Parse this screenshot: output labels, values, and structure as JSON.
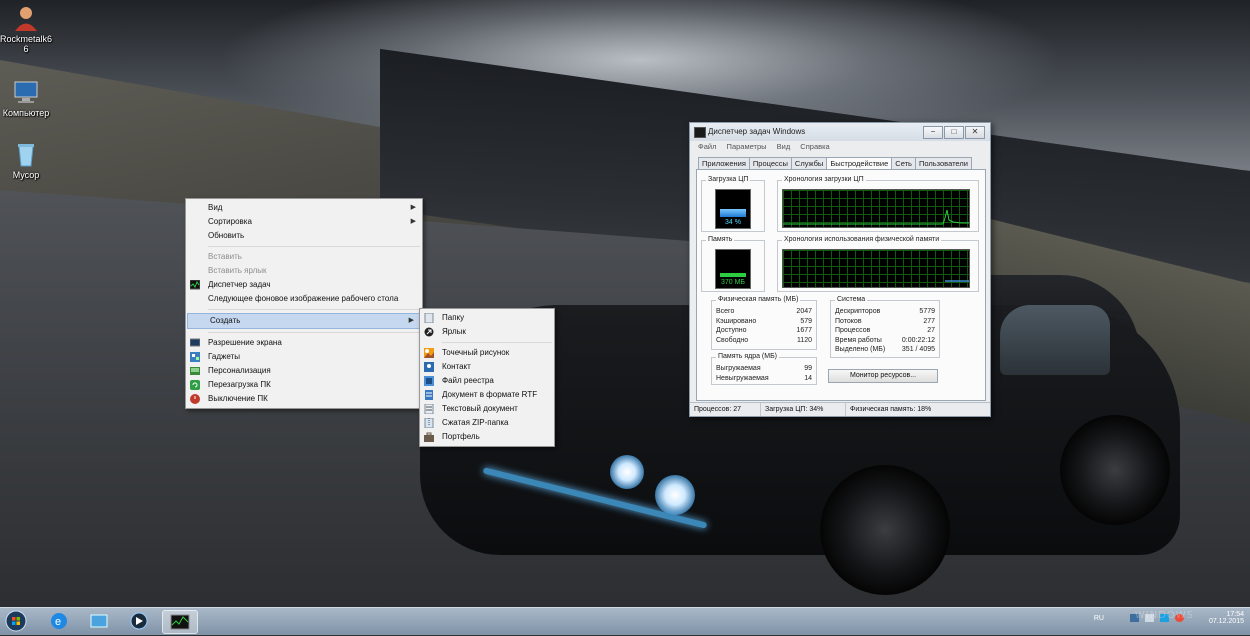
{
  "desktop": {
    "icons": [
      {
        "label": "Rockmetalk6 6",
        "icon": "user-icon"
      },
      {
        "label": "Компьютер",
        "icon": "computer-icon"
      },
      {
        "label": "Мусор",
        "icon": "recycle-bin-icon"
      }
    ]
  },
  "context_menu": {
    "items": [
      {
        "label": "Вид",
        "submenu": true
      },
      {
        "label": "Сортировка",
        "submenu": true
      },
      {
        "label": "Обновить"
      },
      {
        "label": "Вставить",
        "disabled": true
      },
      {
        "label": "Вставить ярлык",
        "disabled": true
      },
      {
        "label": "Диспетчер задач",
        "icon": "task-manager-icon"
      },
      {
        "label": "Следующее фоновое изображение рабочего стола"
      },
      {
        "label": "Создать",
        "submenu": true,
        "highlighted": true
      },
      {
        "label": "Разрешение экрана",
        "icon": "display-icon"
      },
      {
        "label": "Гаджеты",
        "icon": "gadgets-icon"
      },
      {
        "label": "Персонализация",
        "icon": "personalization-icon"
      },
      {
        "label": "Перезагрузка ПК",
        "icon": "restart-icon"
      },
      {
        "label": "Выключение ПК",
        "icon": "shutdown-icon"
      }
    ]
  },
  "create_submenu": {
    "items": [
      {
        "label": "Папку",
        "icon": "folder-icon"
      },
      {
        "label": "Ярлык",
        "icon": "shortcut-icon"
      },
      {
        "label": "Точечный рисунок",
        "icon": "bitmap-icon"
      },
      {
        "label": "Контакт",
        "icon": "contact-icon"
      },
      {
        "label": "Файл реестра",
        "icon": "registry-icon"
      },
      {
        "label": "Документ в формате RTF",
        "icon": "rtf-icon"
      },
      {
        "label": "Текстовый документ",
        "icon": "text-document-icon"
      },
      {
        "label": "Сжатая ZIP-папка",
        "icon": "zip-folder-icon"
      },
      {
        "label": "Портфель",
        "icon": "briefcase-icon"
      }
    ]
  },
  "task_manager": {
    "title": "Диспетчер задач Windows",
    "menu": [
      "Файл",
      "Параметры",
      "Вид",
      "Справка"
    ],
    "tabs": [
      "Приложения",
      "Процессы",
      "Службы",
      "Быстродействие",
      "Сеть",
      "Пользователи"
    ],
    "active_tab": "Быстродействие",
    "cpu_label": "Загрузка ЦП",
    "cpu_value": "34 %",
    "cpu_history_label": "Хронология загрузки ЦП",
    "memory_label": "Память",
    "memory_value": "370 МБ",
    "memory_history_label": "Хронология использования физической памяти",
    "physical_memory": {
      "title": "Физическая память (МБ)",
      "rows": [
        {
          "label": "Всего",
          "value": "2047"
        },
        {
          "label": "Кэшировано",
          "value": "579"
        },
        {
          "label": "Доступно",
          "value": "1677"
        },
        {
          "label": "Свободно",
          "value": "1120"
        }
      ]
    },
    "kernel_memory": {
      "title": "Память ядра (МБ)",
      "rows": [
        {
          "label": "Выгружаемая",
          "value": "99"
        },
        {
          "label": "Невыгружаемая",
          "value": "14"
        }
      ]
    },
    "system": {
      "title": "Система",
      "rows": [
        {
          "label": "Дескрипторов",
          "value": "5779"
        },
        {
          "label": "Потоков",
          "value": "277"
        },
        {
          "label": "Процессов",
          "value": "27"
        },
        {
          "label": "Время работы",
          "value": "0:00:22:12"
        },
        {
          "label": "Выделено (МБ)",
          "value": "351 / 4095"
        }
      ]
    },
    "resource_monitor_button": "Монитор ресурсов...",
    "status": {
      "processes": "Процессов: 27",
      "cpu": "Загрузка ЦП: 34%",
      "memory": "Физическая память: 18%"
    },
    "cpu_fraction": 0.34,
    "memory_fraction": 0.18
  },
  "taskbar": {
    "language": "RU",
    "time": "17:54",
    "date": "07.12.2015",
    "watermark": "WINDOWS"
  }
}
